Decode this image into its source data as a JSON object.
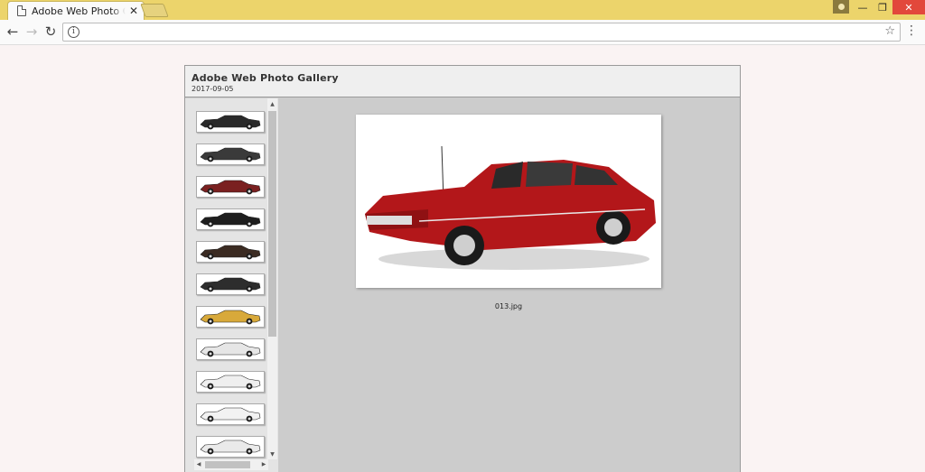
{
  "browser": {
    "tab_title": "Adobe Web Photo Gallery",
    "tab_close_glyph": "✕",
    "url_value": "",
    "icons": [
      "page-icon",
      "close-icon",
      "user-icon",
      "minimize-icon",
      "restore-icon",
      "window-close-icon",
      "back-arrow-icon",
      "forward-arrow-icon",
      "reload-icon",
      "info-icon",
      "star-icon",
      "menu-icon"
    ],
    "glyphs": {
      "back": "←",
      "forward": "→",
      "reload": "↻",
      "info": "i",
      "star": "☆",
      "menu": "⋮",
      "minimize": "—",
      "restore": "❐",
      "close": "✕"
    }
  },
  "gallery": {
    "title": "Adobe Web Photo Gallery",
    "date": "2017-09-05",
    "thumbnails": [
      {
        "color": "#2a2a2a"
      },
      {
        "color": "#3a3a3a"
      },
      {
        "color": "#7a2020"
      },
      {
        "color": "#1e1e1e"
      },
      {
        "color": "#3b2b22"
      },
      {
        "color": "#2d2d2d"
      },
      {
        "color": "#d8a93a"
      },
      {
        "color": "#e6e6e6"
      },
      {
        "color": "#efefef"
      },
      {
        "color": "#f2f2f2"
      },
      {
        "color": "#eaeaea"
      }
    ],
    "main_image_color": "#b3171a",
    "caption": "013.jpg"
  },
  "colors": {
    "titlebar": "#ecd46b",
    "close_button": "#e2483b",
    "gallery_bg": "#cccccc"
  }
}
